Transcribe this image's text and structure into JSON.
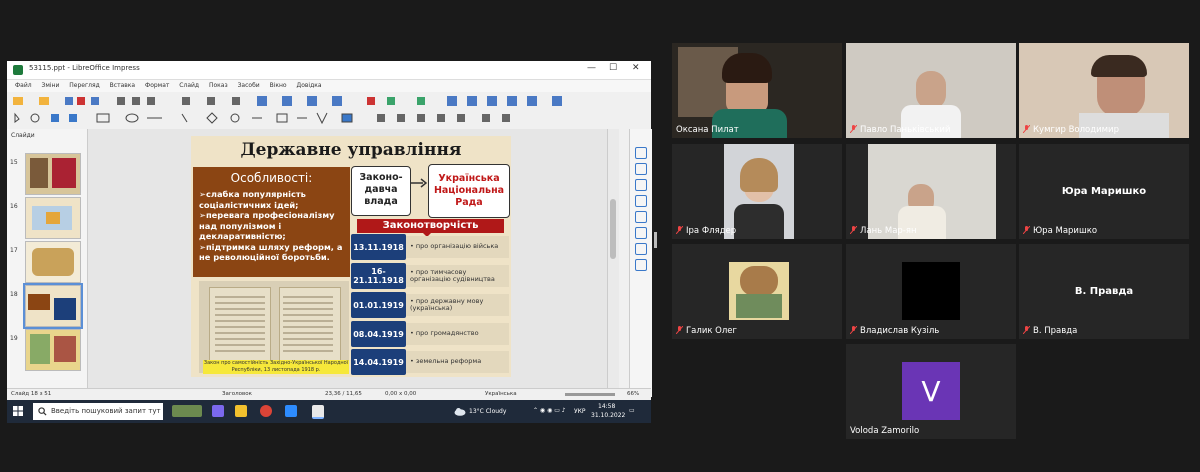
{
  "window": {
    "title": "53115.ppt - LibreOffice Impress"
  },
  "menu": [
    "Файл",
    "Зміни",
    "Перегляд",
    "Вставка",
    "Формат",
    "Слайд",
    "Показ",
    "Засоби",
    "Вікно",
    "Довідка"
  ],
  "slides_panel": {
    "label": "Слайди",
    "thumbs": [
      {
        "num": "15"
      },
      {
        "num": "16"
      },
      {
        "num": "17"
      },
      {
        "num": "18"
      },
      {
        "num": "19"
      }
    ]
  },
  "status": {
    "slide": "Слайд 18 з 51",
    "layout": "Заголовок",
    "coords": "23,36 / 11,65",
    "size": "0,00 x 0,00",
    "lang": "Українська",
    "zoom": "66%"
  },
  "taskbar": {
    "search_placeholder": "Введіть пошуковий запит тут",
    "weather": "13°C  Cloudy",
    "lang": "УКР",
    "time": "14:58",
    "date": "31.10.2022"
  },
  "slide": {
    "title": "Державне управління",
    "features_head": "Особливості:",
    "features": [
      "➢слабка популярність соціалістичних ідей;",
      "➢перевага професіоналізму над популізмом і декларативністю;",
      "➢підтримка шляху реформ, а не революційної боротьби."
    ],
    "power_box": "Законо-давча влада",
    "rada_box": "Українська Національна Рада",
    "legis_header": "Законотворчість",
    "rows": [
      {
        "date": "13.11.1918",
        "desc": "• про організацію війська"
      },
      {
        "date": "16-21.11.1918",
        "desc": "• про тимчасову організацію судівництва"
      },
      {
        "date": "01.01.1919",
        "desc": "• про державну мову (українська)"
      },
      {
        "date": "08.04.1919",
        "desc": "• про громадянство"
      },
      {
        "date": "14.04.1919",
        "desc": "• земельна реформа"
      }
    ],
    "doc_caption": "Закон про самостійність Західно-Української Народної Республіки, 13 листопада 1918 р."
  },
  "participants": [
    {
      "name": "Оксана Пилат",
      "muted": false,
      "active": true
    },
    {
      "name": "Павло Паньківський",
      "muted": true
    },
    {
      "name": "Кумгир Володимир",
      "muted": true
    },
    {
      "name": "Іра Флядер",
      "muted": true
    },
    {
      "name": "Лань Мар-ян",
      "muted": true
    },
    {
      "name": "Юра Маришко",
      "muted": true,
      "center_label": "Юра Маришко"
    },
    {
      "name": "Галик Олег",
      "muted": true
    },
    {
      "name": "Владислав Кузіль",
      "muted": true
    },
    {
      "name": "В. Правда",
      "muted": true,
      "center_label": "В. Правда"
    },
    {
      "name": "Voloda Zamorilo",
      "muted": false,
      "avatar_letter": "V"
    }
  ],
  "colors": {
    "accent": "#b01818",
    "active": "#d2e65a",
    "navy": "#1c3f7a"
  }
}
